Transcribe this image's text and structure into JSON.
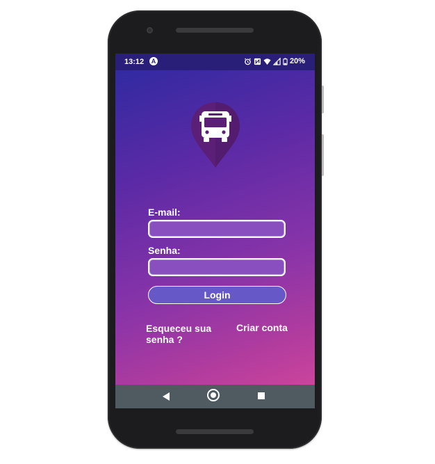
{
  "status_bar": {
    "time": "13:12",
    "notification_icon": "A",
    "icons": [
      "alarm-icon",
      "nfc-icon",
      "wifi-icon",
      "signal-icon",
      "battery-icon"
    ],
    "battery": "20%"
  },
  "app": {
    "logo_icon": "bus-location-pin-icon",
    "email_label": "E-mail:",
    "email_value": "",
    "password_label": "Senha:",
    "password_value": "",
    "login_button": "Login",
    "forgot_password": "Esqueceu sua senha ?",
    "create_account": "Criar conta"
  },
  "nav_bar": {
    "icons": [
      "back-icon",
      "home-icon",
      "recents-icon"
    ]
  },
  "colors": {
    "gradient_top": "#2b2aa0",
    "gradient_bottom": "#d6489a",
    "status_bar": "#2a1f78",
    "login_button": "#6658c6",
    "logo_pin": "#5b1f78",
    "nav_bar": "#4f5b61"
  }
}
